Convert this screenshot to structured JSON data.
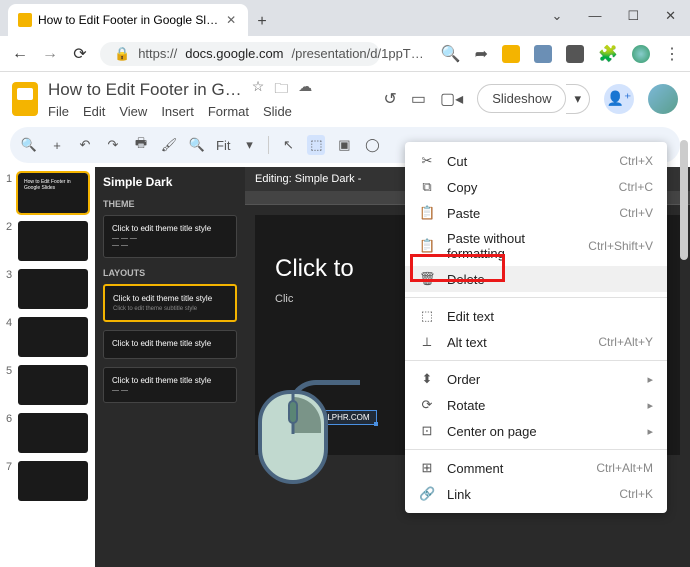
{
  "browser": {
    "tab_title": "How to Edit Footer in Google Sl…",
    "url_prefix": "https://",
    "url_host": "docs.google.com",
    "url_path": "/presentation/d/1ppT…"
  },
  "doc": {
    "title": "How to Edit Footer in G…",
    "menus": [
      "File",
      "Edit",
      "View",
      "Insert",
      "Format",
      "Slide"
    ],
    "slideshow": "Slideshow"
  },
  "toolbar": {
    "zoom": "Fit"
  },
  "thumbs": {
    "slide1_text": "How to Edit Footer in Google Slides",
    "items": [
      "1",
      "2",
      "3",
      "4",
      "5",
      "6",
      "7"
    ]
  },
  "theme_panel": {
    "name": "Simple Dark",
    "section1": "THEME",
    "card1": "Click to edit theme title style",
    "section2": "LAYOUTS",
    "card2": "Click to edit theme title style",
    "card3": "Click to edit theme title style",
    "card4": "Click to edit theme title style"
  },
  "editor": {
    "header": "Editing: Simple Dark -",
    "big": "Click to",
    "sub": "Clic",
    "selected_text": "ALPHR.COM"
  },
  "ctx": {
    "cut": {
      "label": "Cut",
      "sc": "Ctrl+X"
    },
    "copy": {
      "label": "Copy",
      "sc": "Ctrl+C"
    },
    "paste": {
      "label": "Paste",
      "sc": "Ctrl+V"
    },
    "paste_nf": {
      "label": "Paste without formatting",
      "sc": "Ctrl+Shift+V"
    },
    "delete": {
      "label": "Delete",
      "sc": ""
    },
    "edit_text": {
      "label": "Edit text",
      "sc": ""
    },
    "alt_text": {
      "label": "Alt text",
      "sc": "Ctrl+Alt+Y"
    },
    "order": {
      "label": "Order"
    },
    "rotate": {
      "label": "Rotate"
    },
    "center": {
      "label": "Center on page"
    },
    "comment": {
      "label": "Comment",
      "sc": "Ctrl+Alt+M"
    },
    "link": {
      "label": "Link",
      "sc": "Ctrl+K"
    }
  }
}
